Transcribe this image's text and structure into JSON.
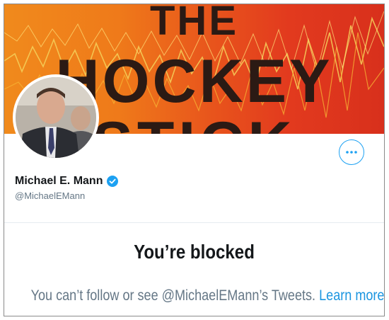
{
  "banner": {
    "line1": "THE",
    "line2": "HOCKEY",
    "line3": "STICK"
  },
  "profile": {
    "name": "Michael E. Mann",
    "handle": "@MichaelEMann",
    "more_icon": "more-horizontal-icon",
    "verified_icon": "verified-badge-icon"
  },
  "blocked": {
    "title": "You’re blocked",
    "message": "You can’t follow or see @MichaelEMann’s Tweets.",
    "link": "Learn more"
  },
  "colors": {
    "accent": "#1da1f2",
    "banner_orange": "#f08a1c",
    "banner_red": "#d8301c",
    "muted_text": "#657786"
  }
}
